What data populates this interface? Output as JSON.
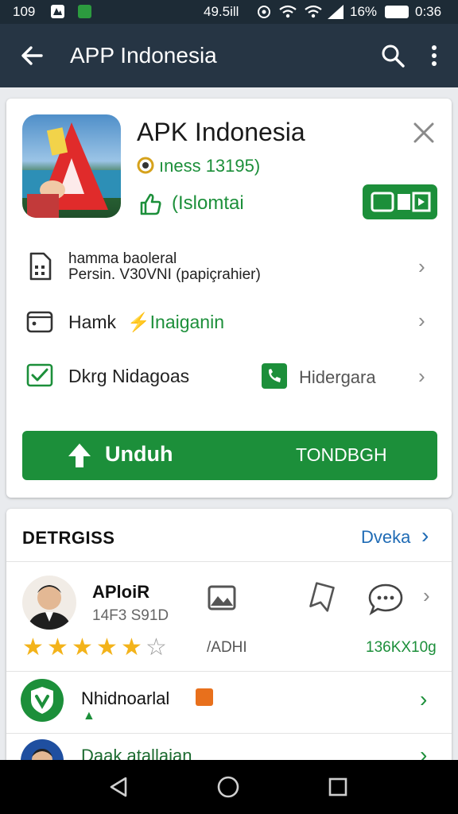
{
  "status_bar": {
    "time": "109",
    "right_text": "49.5ill",
    "battery": "16%",
    "clock": "0:36"
  },
  "app_bar": {
    "title": "APP Indonesia"
  },
  "app": {
    "name": "APK Indonesia",
    "meta": "ıness 13195)",
    "tag": "(Islomtai",
    "rows": [
      {
        "title_line1": "hamma baoleral",
        "title_line2": "Persin.  V30VNI (papiçrahier)"
      },
      {
        "title": "Hamk",
        "accent": "Inaiganin"
      },
      {
        "title": "Dkrg Nidagoas",
        "right": "Hidergara"
      }
    ],
    "primary_button": {
      "label": "Unduh",
      "secondary": "TONDBGH"
    }
  },
  "details": {
    "heading": "DETRGISS",
    "link": "Dveka",
    "review": {
      "name": "APloiR",
      "sub": "14F3 S91D",
      "mid_label": "/ADHI",
      "right_label": "136KX10g",
      "rating": 5
    },
    "items": [
      {
        "title": "Nhidnoarlal"
      },
      {
        "title": "Daak atallaian"
      }
    ]
  },
  "colors": {
    "accent_green": "#1c8f3a",
    "app_bar": "#263544",
    "status_bar": "#1d2b36",
    "link_blue": "#1f6bb5",
    "star": "#f3b31a"
  }
}
